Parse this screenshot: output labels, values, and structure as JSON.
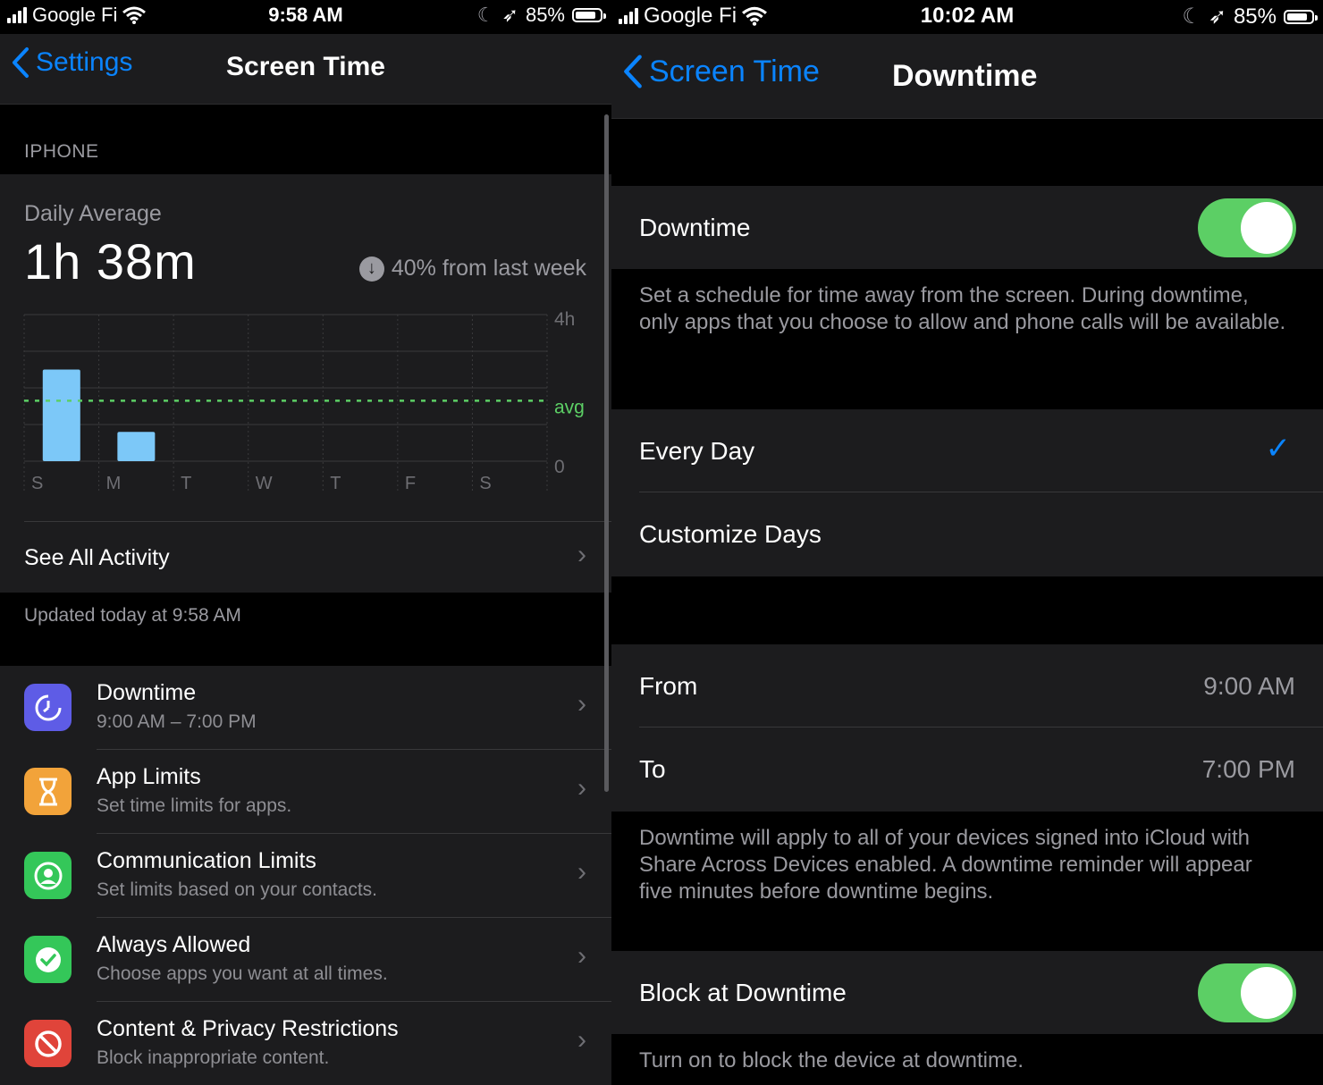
{
  "left": {
    "status": {
      "carrier": "Google Fi",
      "time": "9:58 AM",
      "battery": "85%"
    },
    "nav": {
      "back_label": "Settings",
      "title": "Screen Time"
    },
    "section_header": "IPHONE",
    "summary": {
      "label": "Daily Average",
      "value": "1h 38m",
      "delta": "40% from last week"
    },
    "see_all": "See All Activity",
    "updated": "Updated today at 9:58 AM",
    "items": [
      {
        "title": "Downtime",
        "subtitle": "9:00 AM – 7:00 PM",
        "icon": "downtime-icon",
        "color": "#5e5ce6"
      },
      {
        "title": "App Limits",
        "subtitle": "Set time limits for apps.",
        "icon": "hourglass-icon",
        "color": "#f2a33a"
      },
      {
        "title": "Communication Limits",
        "subtitle": "Set limits based on your contacts.",
        "icon": "contact-icon",
        "color": "#34c759"
      },
      {
        "title": "Always Allowed",
        "subtitle": "Choose apps you want at all times.",
        "icon": "checkmark-seal-icon",
        "color": "#34c759"
      },
      {
        "title": "Content & Privacy Restrictions",
        "subtitle": "Block inappropriate content.",
        "icon": "restriction-icon",
        "color": "#e0443a"
      }
    ]
  },
  "right": {
    "status": {
      "carrier": "Google Fi",
      "time": "10:02 AM",
      "battery": "85%"
    },
    "nav": {
      "back_label": "Screen Time",
      "title": "Downtime"
    },
    "downtime_label": "Downtime",
    "downtime_on": true,
    "downtime_desc": "Set a schedule for time away from the screen. During downtime, only apps that you choose to allow and phone calls will be available.",
    "every_day": "Every Day",
    "customize_days": "Customize Days",
    "from_label": "From",
    "from_value": "9:00 AM",
    "to_label": "To",
    "to_value": "7:00 PM",
    "schedule_note": "Downtime will apply to all of your devices signed into iCloud with Share Across Devices enabled. A downtime reminder will appear five minutes before downtime begins.",
    "block_label": "Block at Downtime",
    "block_on": true,
    "block_desc": "Turn on to block the device at downtime."
  },
  "chart_data": {
    "type": "bar",
    "categories": [
      "S",
      "M",
      "T",
      "W",
      "T",
      "F",
      "S"
    ],
    "values": [
      2.5,
      0.8,
      0,
      0,
      0,
      0,
      0
    ],
    "average": 1.65,
    "ylim": [
      0,
      4
    ],
    "y_ticks": [
      "0",
      "avg",
      "4h"
    ],
    "grid": true,
    "bar_color": "#7cc8f8",
    "avg_color": "#5ccf65"
  }
}
